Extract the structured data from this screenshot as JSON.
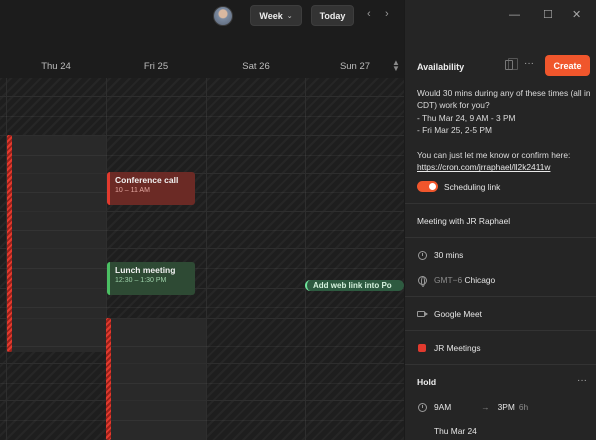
{
  "toolbar": {
    "view_label": "Week",
    "today_label": "Today",
    "prev_icon": "chevron-left",
    "next_icon": "chevron-right"
  },
  "calendar": {
    "days": [
      "Thu 24",
      "Fri 25",
      "Sat 26",
      "Sun 27"
    ],
    "events": [
      {
        "title": "Conference call",
        "time": "10 – 11 AM",
        "color": "#e23a2e"
      },
      {
        "title": "Lunch meeting",
        "time": "12:30 – 1:30 PM",
        "color": "#4bbf63"
      }
    ],
    "web_link_pill": "Add web link into Po"
  },
  "panel": {
    "heading": "Availability",
    "create_label": "Create",
    "message": {
      "line1": "Would 30 mins during any of these times (all in CDT) work for you?",
      "line2": "- Thu Mar 24, 9 AM - 3 PM",
      "line3": "- Fri Mar 25, 2-5 PM",
      "line4": "You can just let me know or confirm here:",
      "link": "https://cron.com/jrraphael/ll2k2411w"
    },
    "scheduling_link_label": "Scheduling link",
    "scheduling_link_on": true,
    "meeting_title": "Meeting with JR Raphael",
    "duration": "30 mins",
    "timezone_offset": "GMT−6",
    "timezone_city": "Chicago",
    "conferencing": "Google Meet",
    "calendar_name": "JR Meetings",
    "calendar_color": "#e23a2e",
    "hold": {
      "title": "Hold",
      "start": "9AM",
      "end": "3PM",
      "duration": "6h",
      "date": "Thu Mar 24"
    }
  },
  "colors": {
    "accent": "#f0562c",
    "background": "#1c1c1c",
    "panel": "#252525"
  }
}
